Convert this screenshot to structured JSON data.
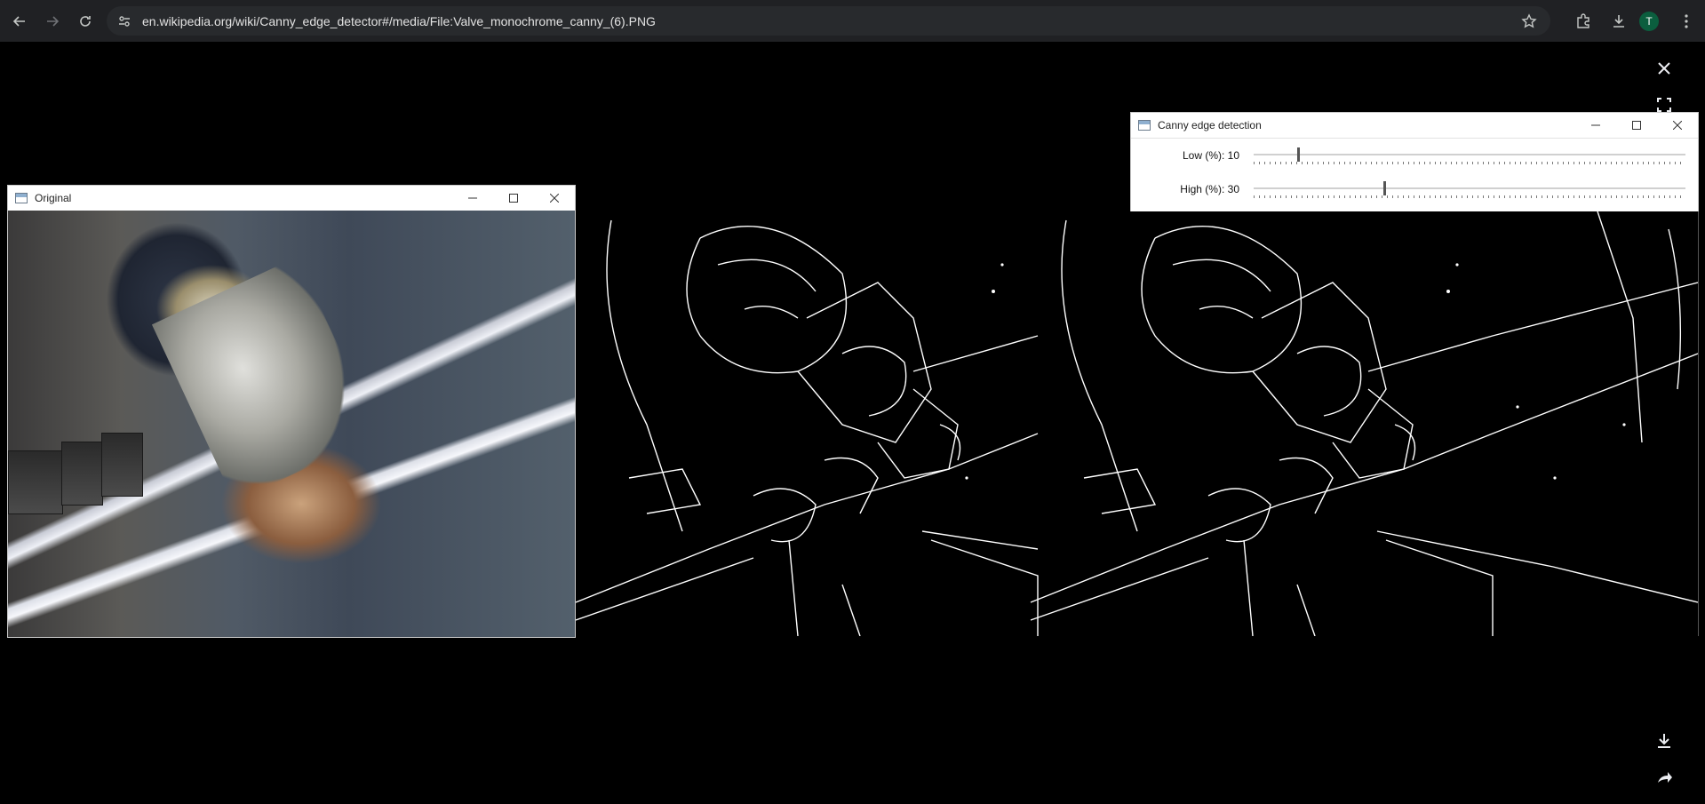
{
  "browser": {
    "url": "en.wikipedia.org/wiki/Canny_edge_detector#/media/File:Valve_monochrome_canny_(6).PNG",
    "avatar_letter": "T"
  },
  "windows": {
    "original": {
      "title": "Original"
    },
    "canny": {
      "title": "Canny edge detection",
      "low_label": "Low (%): 10",
      "high_label": "High (%): 30",
      "low_value_percent": 10,
      "high_value_percent": 30
    }
  },
  "icons": {
    "back": "back-arrow-icon",
    "forward": "forward-arrow-icon",
    "reload": "reload-icon",
    "site_info": "tune-icon",
    "bookmark": "star-icon",
    "extensions": "puzzle-icon",
    "downloads": "download-icon",
    "close_viewer": "close-icon",
    "fullscreen": "fullscreen-icon",
    "download_file": "download-icon",
    "share": "share-icon"
  }
}
